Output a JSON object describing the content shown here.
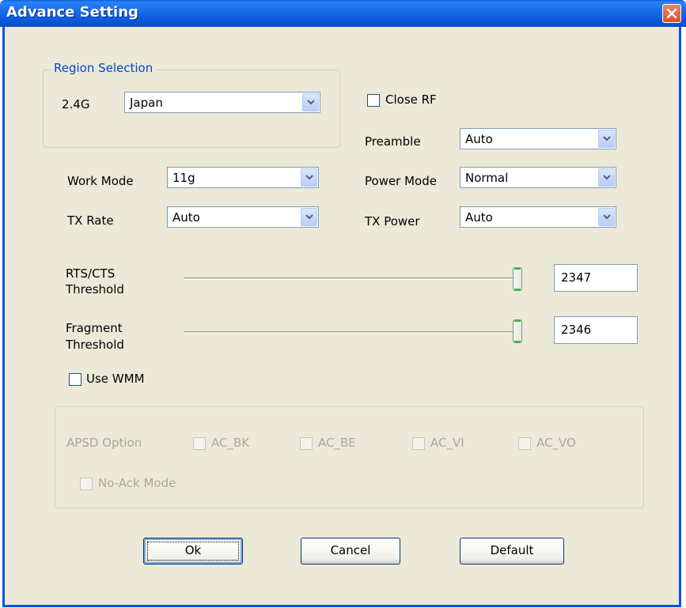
{
  "window": {
    "title": "Advance Setting"
  },
  "region_group": {
    "title": "Region Selection",
    "label_24g": "2.4G",
    "region_value": "Japan"
  },
  "close_rf": {
    "label": "Close RF",
    "checked": false
  },
  "preamble": {
    "label": "Preamble",
    "value": "Auto"
  },
  "power_mode": {
    "label": "Power Mode",
    "value": "Normal"
  },
  "tx_power": {
    "label": "TX Power",
    "value": "Auto"
  },
  "work_mode": {
    "label": "Work Mode",
    "value": "11g"
  },
  "tx_rate": {
    "label": "TX Rate",
    "value": "Auto"
  },
  "rts": {
    "label_line1": "RTS/CTS",
    "label_line2": "Threshold",
    "value": "2347"
  },
  "fragment": {
    "label_line1": "Fragment",
    "label_line2": "Threshold",
    "value": "2346"
  },
  "use_wmm": {
    "label": "Use WMM",
    "checked": false
  },
  "apsd": {
    "label": "APSD Option",
    "options": [
      "AC_BK",
      "AC_BE",
      "AC_VI",
      "AC_VO"
    ],
    "no_ack": "No-Ack Mode"
  },
  "buttons": {
    "ok": "Ok",
    "cancel": "Cancel",
    "default": "Default"
  },
  "colors": {
    "title_bar": "#0a56d8",
    "client_bg": "#ece9d8",
    "group_title": "#0046d5",
    "disabled_text": "#aca899"
  }
}
